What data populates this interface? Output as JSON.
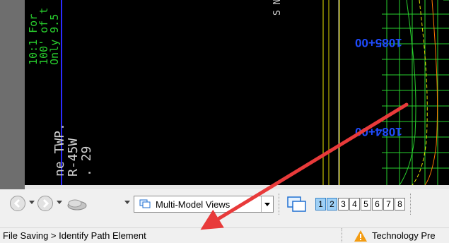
{
  "view": {
    "station_labels": [
      "1085+00",
      "1084+00"
    ],
    "note_lines": [
      "10:1 For",
      "100' of t",
      "Only 9.5"
    ],
    "township_lines": [
      "ne TWP.",
      "R-45W",
      ". 29"
    ],
    "top_fragment": "S N D"
  },
  "toolbar": {
    "back_icon": "back-arrow-icon",
    "forward_icon": "forward-arrow-icon",
    "display_icon": "display-style-icon",
    "view_select": "Multi-Model Views",
    "view_icon": "multi-model-views-icon",
    "view_windows_icon": "view-windows-icon",
    "view_numbers": [
      "1",
      "2",
      "3",
      "4",
      "5",
      "6",
      "7",
      "8"
    ],
    "active_views": [
      "1",
      "2"
    ]
  },
  "statusbar": {
    "message": "File Saving > Identify Path Element",
    "warning_icon": "warning-icon",
    "technology_label": "Technology Pre"
  },
  "colors": {
    "viewport_bg": "#000000",
    "design_green": "#29d12e",
    "station_blue": "#1f4cff",
    "annotation_arrow": "#e83a3a"
  }
}
